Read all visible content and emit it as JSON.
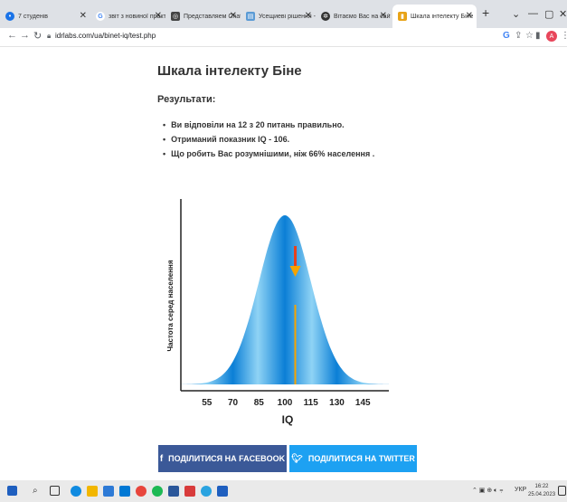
{
  "browser": {
    "tabs": [
      {
        "label": "7 студенів",
        "icon": "globe-blue",
        "color": "#1a73e8"
      },
      {
        "label": "звіт з новиної практики з н",
        "icon": "google-g",
        "color": "#4285f4"
      },
      {
        "label": "Представляем ChatGPT",
        "icon": "openai",
        "color": "#444444"
      },
      {
        "label": "Усещиеві рішення - авто",
        "icon": "doc",
        "color": "#5b9bd5"
      },
      {
        "label": "Вітаємо Вас на сайті наші",
        "icon": "chatgpt",
        "color": "#333333"
      },
      {
        "label": "Шкала інтелекту Біне",
        "icon": "idrlabs",
        "color": "#e8a317"
      }
    ],
    "address": "idrlabs.com/ua/binet-iq/test.php",
    "profile_initial": "A"
  },
  "page": {
    "title": "Шкала інтелекту Біне",
    "results_heading": "Результати:",
    "results": [
      "Ви відповіли на 12 з 20 питань правильно.",
      "Отриманий показник IQ - 106.",
      "Що робить Вас розумнішими, ніж 66% населення ."
    ],
    "share_facebook": "ПОДІЛИТИСЯ НА FACEBOOK",
    "share_twitter": "ПОДІЛИТИСЯ НА TWITTER"
  },
  "chart_data": {
    "type": "area",
    "distribution": "normal",
    "mean": 100,
    "sd": 15,
    "x_ticks": [
      55,
      70,
      85,
      100,
      115,
      130,
      145
    ],
    "xlabel": "IQ",
    "ylabel": "Частота серед населення",
    "marker_value": 106,
    "colors": {
      "curve_light": "#8fd3f5",
      "curve_dark": "#0b7fd6",
      "marker_line": "#f5a300",
      "arrow": "#e8401c"
    }
  },
  "taskbar": {
    "time": "16:22",
    "date": "25.04.2023",
    "lang": "УКР"
  }
}
